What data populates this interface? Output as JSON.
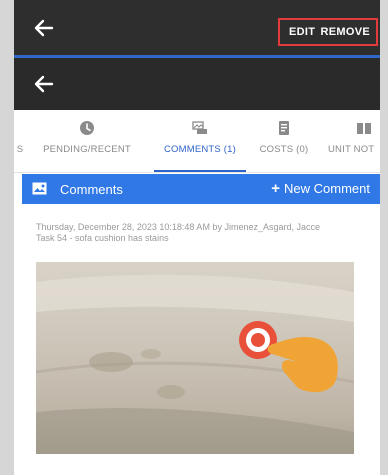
{
  "top_bar": {
    "edit_label": "EDIT",
    "remove_label": "REMOVE"
  },
  "tabs": [
    {
      "label": "S"
    },
    {
      "label": "PENDING/RECENT"
    },
    {
      "label": "COMMENTS (1)"
    },
    {
      "label": "COSTS (0)"
    },
    {
      "label": "UNIT NOT"
    }
  ],
  "comments_bar": {
    "title": "Comments",
    "new_comment_label": "New Comment"
  },
  "comment": {
    "meta": "Thursday, December 28, 2023 10:18:48 AM by Jimenez_Asgard, Jacce",
    "text": "Task 54 - sofa cushion has stains"
  },
  "colors": {
    "top_bar": "#2e2e2e",
    "accent_blue": "#2f78e6",
    "active_tab": "#2f63c7",
    "highlight_border": "#e23b3b",
    "tap_target": "#e8503a",
    "hand": "#f1a436"
  },
  "icons": {
    "back": "arrow-left-icon",
    "pending": "clock-icon",
    "comments": "comment-image-icon",
    "costs": "receipt-icon",
    "unit_notes": "book-icon",
    "comments_bar": "image-icon",
    "tap": "tap-target-icon",
    "pointer": "pointing-hand-icon"
  }
}
